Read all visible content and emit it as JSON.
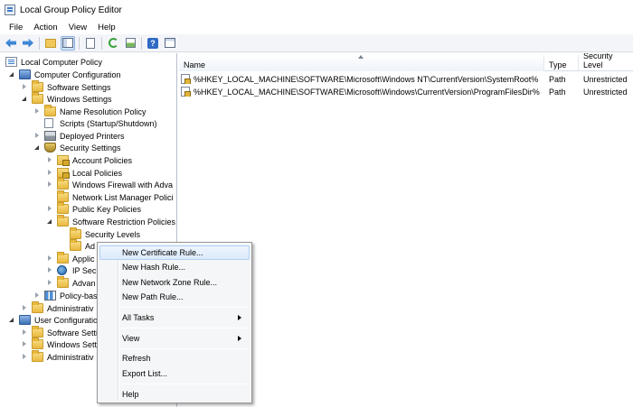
{
  "window": {
    "title": "Local Group Policy Editor"
  },
  "menubar": {
    "items": [
      "File",
      "Action",
      "View",
      "Help"
    ]
  },
  "toolbar": {
    "help_glyph": "?"
  },
  "tree": {
    "items": [
      {
        "label": "Local Computer Policy"
      },
      {
        "label": "Computer Configuration"
      },
      {
        "label": "Software Settings"
      },
      {
        "label": "Windows Settings"
      },
      {
        "label": "Name Resolution Policy"
      },
      {
        "label": "Scripts (Startup/Shutdown)"
      },
      {
        "label": "Deployed Printers"
      },
      {
        "label": "Security Settings"
      },
      {
        "label": "Account Policies"
      },
      {
        "label": "Local Policies"
      },
      {
        "label": "Windows Firewall with Adva"
      },
      {
        "label": "Network List Manager Polici"
      },
      {
        "label": "Public Key Policies"
      },
      {
        "label": "Software Restriction Policies"
      },
      {
        "label": "Security Levels"
      },
      {
        "label": "Ad"
      },
      {
        "label": "Applic"
      },
      {
        "label": "IP Secu"
      },
      {
        "label": "Advan"
      },
      {
        "label": "Policy-bas"
      },
      {
        "label": "Administrativ"
      },
      {
        "label": "User Configuratio"
      },
      {
        "label": "Software Setti"
      },
      {
        "label": "Windows Sett"
      },
      {
        "label": "Administrativ"
      }
    ]
  },
  "list": {
    "columns": [
      "Name",
      "Type",
      "Security Level"
    ],
    "rows": [
      {
        "name": "%HKEY_LOCAL_MACHINE\\SOFTWARE\\Microsoft\\Windows NT\\CurrentVersion\\SystemRoot%",
        "type": "Path",
        "level": "Unrestricted"
      },
      {
        "name": "%HKEY_LOCAL_MACHINE\\SOFTWARE\\Microsoft\\Windows\\CurrentVersion\\ProgramFilesDir%",
        "type": "Path",
        "level": "Unrestricted"
      }
    ]
  },
  "context_menu": {
    "items": [
      "New Certificate Rule...",
      "New Hash Rule...",
      "New Network Zone Rule...",
      "New Path Rule...",
      "All Tasks",
      "View",
      "Refresh",
      "Export List...",
      "Help"
    ]
  }
}
